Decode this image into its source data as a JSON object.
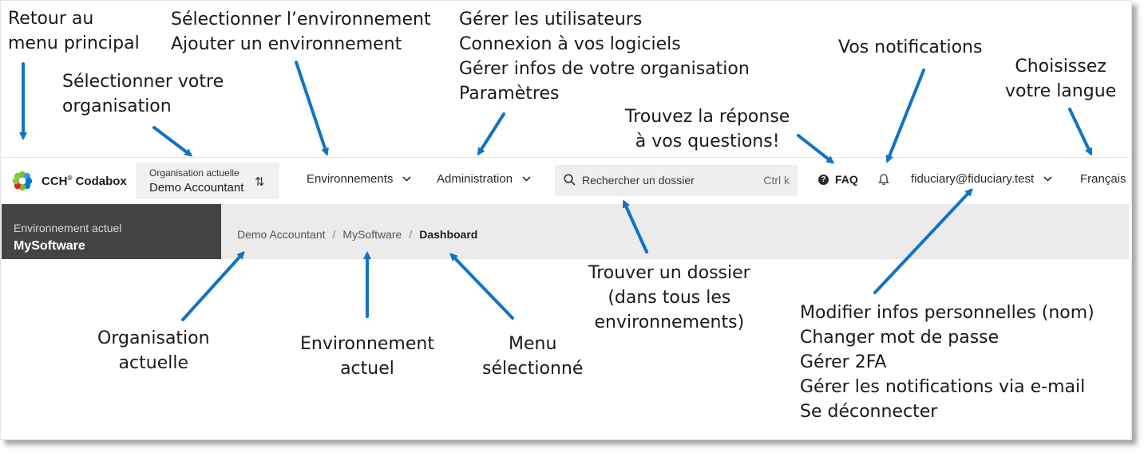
{
  "annotations": {
    "back_main": "Retour au\nmenu principal",
    "select_org": "Sélectionner votre\norganisation",
    "env_select": "Sélectionner l’environnement\nAjouter un environnement",
    "admin_list": "Gérer les utilisateurs\nConnexion à vos logiciels\nGérer infos de votre organisation\nParamètres",
    "notifications": "Vos notifications",
    "language": "Choisissez\nvotre langue",
    "faq": "Trouvez la réponse\nà vos questions!",
    "find_folder": "Trouver un dossier\n(dans tous les\nenvironnements)",
    "user_menu": "Modifier infos personnelles (nom)\nChanger mot de passe\nGérer 2FA\nGérer les notifications via e-mail\nSe déconnecter",
    "org_current": "Organisation\nactuelle",
    "env_current": "Environnement\nactuel",
    "menu_selected": "Menu\nsélectionné"
  },
  "header": {
    "brand": "CCH",
    "brand_reg": "®",
    "brand_product": "Codabox",
    "org_label": "Organisation actuelle",
    "org_value": "Demo Accountant",
    "nav_environments": "Environnements",
    "nav_admin": "Administration",
    "search_placeholder": "Rechercher un dossier",
    "search_shortcut": "Ctrl k",
    "faq": "FAQ",
    "user_email": "fiduciary@fiduciary.test",
    "language": "Français"
  },
  "subheader": {
    "env_label": "Environnement actuel",
    "env_value": "MySoftware",
    "breadcrumb": [
      "Demo Accountant",
      "MySoftware",
      "Dashboard"
    ]
  },
  "icons": {
    "logo": "wolters-kluwer-logo-icon",
    "switch": "swap-vertical-icon",
    "chevron": "chevron-down-icon",
    "search": "search-icon",
    "faq": "help-circle-icon",
    "bell": "bell-icon"
  },
  "colors": {
    "arrow": "#1273c4",
    "env_panel": "#444444",
    "breadcrumb_bar": "#ebebeb"
  }
}
